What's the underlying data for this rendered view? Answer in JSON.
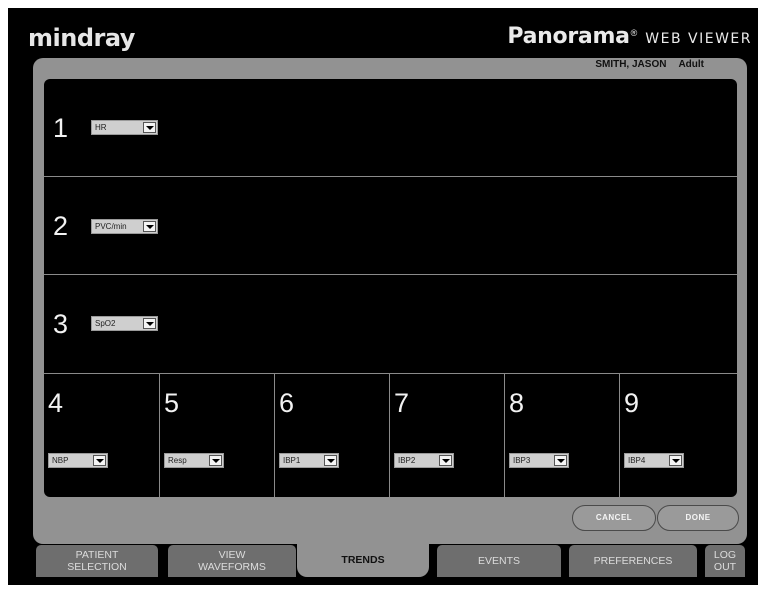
{
  "header": {
    "brand": "mindray",
    "product": "Panorama",
    "product_reg": "®",
    "product_suffix": "WEB VIEWER"
  },
  "patient": {
    "name": "SMITH, JASON",
    "category": "Adult"
  },
  "trend_rows": [
    {
      "number": "1",
      "parameter": "HR"
    },
    {
      "number": "2",
      "parameter": "PVC/min"
    },
    {
      "number": "3",
      "parameter": "SpO2"
    }
  ],
  "trend_cells": [
    {
      "number": "4",
      "parameter": "NBP"
    },
    {
      "number": "5",
      "parameter": "Resp"
    },
    {
      "number": "6",
      "parameter": "IBP1"
    },
    {
      "number": "7",
      "parameter": "IBP2"
    },
    {
      "number": "8",
      "parameter": "IBP3"
    },
    {
      "number": "9",
      "parameter": "IBP4"
    }
  ],
  "actions": {
    "cancel": "CANCEL",
    "done": "DONE"
  },
  "tabs": {
    "patient_selection": "PATIENT\nSELECTION",
    "view_waveforms": "VIEW\nWAVEFORMS",
    "trends": "TRENDS",
    "events": "EVENTS",
    "preferences": "PREFERENCES",
    "logout": "LOG\nOUT",
    "active": "trends"
  },
  "colors": {
    "background": "#000000",
    "frame": "#929292",
    "tab_inactive": "#6e6e6e"
  }
}
